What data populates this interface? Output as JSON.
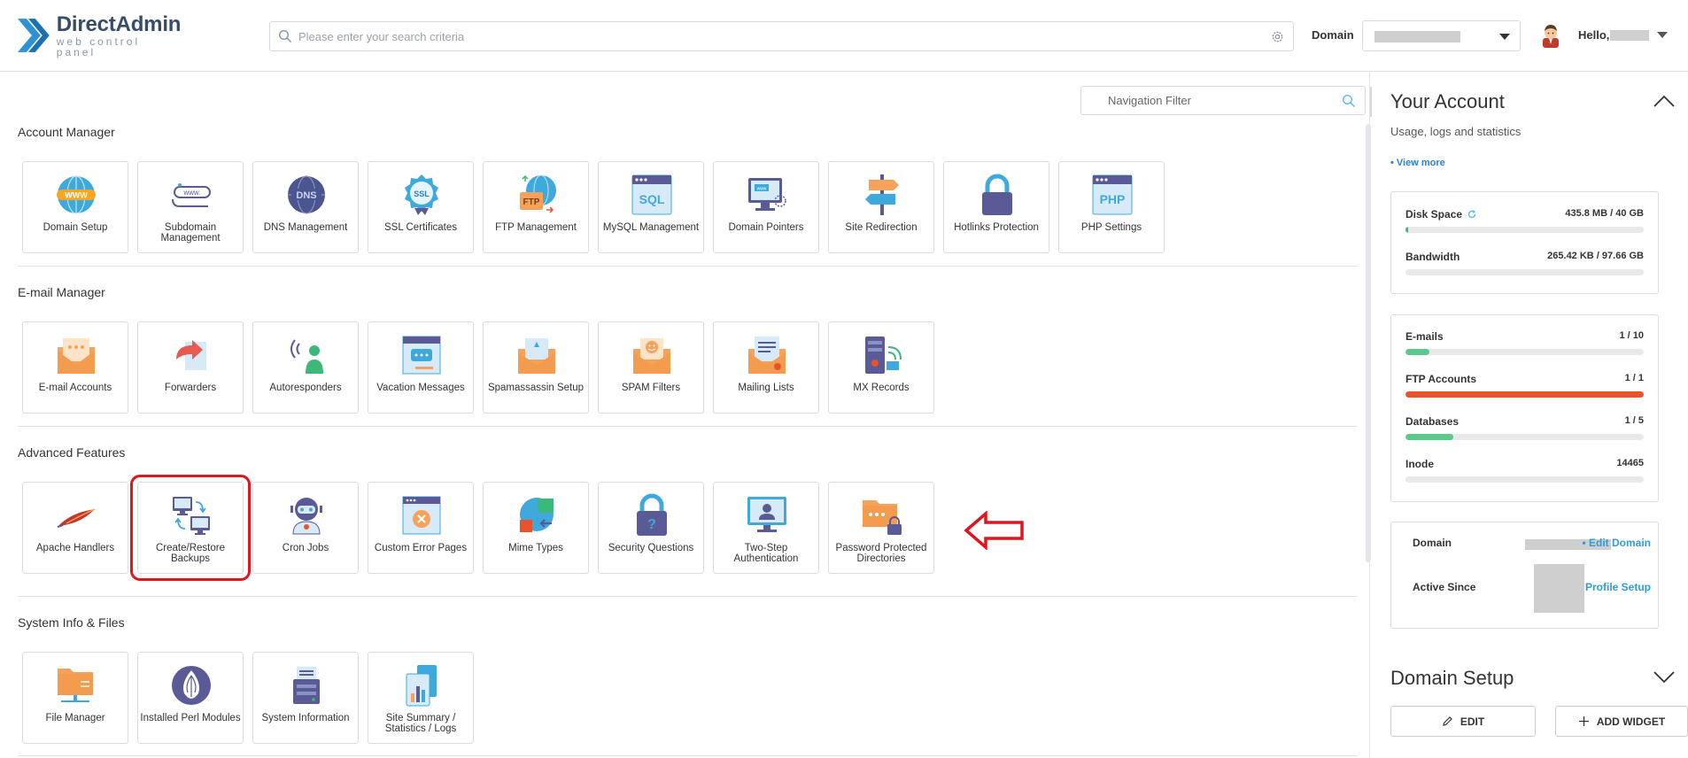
{
  "header": {
    "logo_name": "DirectAdmin",
    "logo_sub": "web control panel",
    "search_placeholder": "Please enter your search criteria",
    "domain_label": "Domain",
    "hello": "Hello,"
  },
  "main": {
    "nav_filter_placeholder": "Navigation Filter",
    "sections": [
      {
        "title": "Account Manager",
        "items": [
          "Domain Setup",
          "Subdomain Management",
          "DNS Management",
          "SSL Certificates",
          "FTP Management",
          "MySQL Management",
          "Domain Pointers",
          "Site Redirection",
          "Hotlinks Protection",
          "PHP Settings"
        ]
      },
      {
        "title": "E-mail Manager",
        "items": [
          "E-mail Accounts",
          "Forwarders",
          "Autoresponders",
          "Vacation Messages",
          "Spamassassin Setup",
          "SPAM Filters",
          "Mailing Lists",
          "MX Records"
        ]
      },
      {
        "title": "Advanced Features",
        "items": [
          "Apache Handlers",
          "Create/Restore Backups",
          "Cron Jobs",
          "Custom Error Pages",
          "Mime Types",
          "Security Questions",
          "Two-Step Authentication",
          "Password Protected Directories"
        ]
      },
      {
        "title": "System Info & Files",
        "items": [
          "File Manager",
          "Installed Perl Modules",
          "System Information",
          "Site Summary / Statistics / Logs"
        ]
      }
    ],
    "icon_text": {
      "www": "WWW",
      "dns": "DNS",
      "ssl": "SSL",
      "ftp": "FTP",
      "sql": "SQL",
      "php": "PHP"
    }
  },
  "account": {
    "title": "Your Account",
    "subtitle": "Usage, logs and statistics",
    "view_more": "• View more",
    "usage": [
      {
        "name": "Disk Space",
        "value": "435.8 MB / 40 GB",
        "fraction": 0.011,
        "color": "#3cb878"
      },
      {
        "name": "Bandwidth",
        "value": "265.42 KB / 97.66 GB",
        "fraction": 0.0,
        "color": "#3cb878"
      }
    ],
    "limits": [
      {
        "name": "E-mails",
        "value": "1 / 10",
        "fraction": 0.1,
        "color": "#5bc98a"
      },
      {
        "name": "FTP Accounts",
        "value": "1 / 1",
        "fraction": 1.0,
        "color": "#e8532b"
      },
      {
        "name": "Databases",
        "value": "1 / 5",
        "fraction": 0.2,
        "color": "#5bc98a"
      },
      {
        "name": "Inode",
        "value": "14465",
        "fraction": 0.0,
        "color": "#5bc98a"
      }
    ],
    "domain_label": "Domain",
    "edit_domain": "• Edit Domain",
    "active_since_label": "Active Since",
    "profile_setup": "• Profile Setup"
  },
  "domain_setup": {
    "title": "Domain Setup",
    "edit_btn": "EDIT",
    "add_widget_btn": "ADD WIDGET"
  },
  "colors": {
    "brand": "#2e93d5",
    "highlight": "#e2141e",
    "accent_orange": "#f6a25a",
    "purple": "#5a5a96"
  }
}
